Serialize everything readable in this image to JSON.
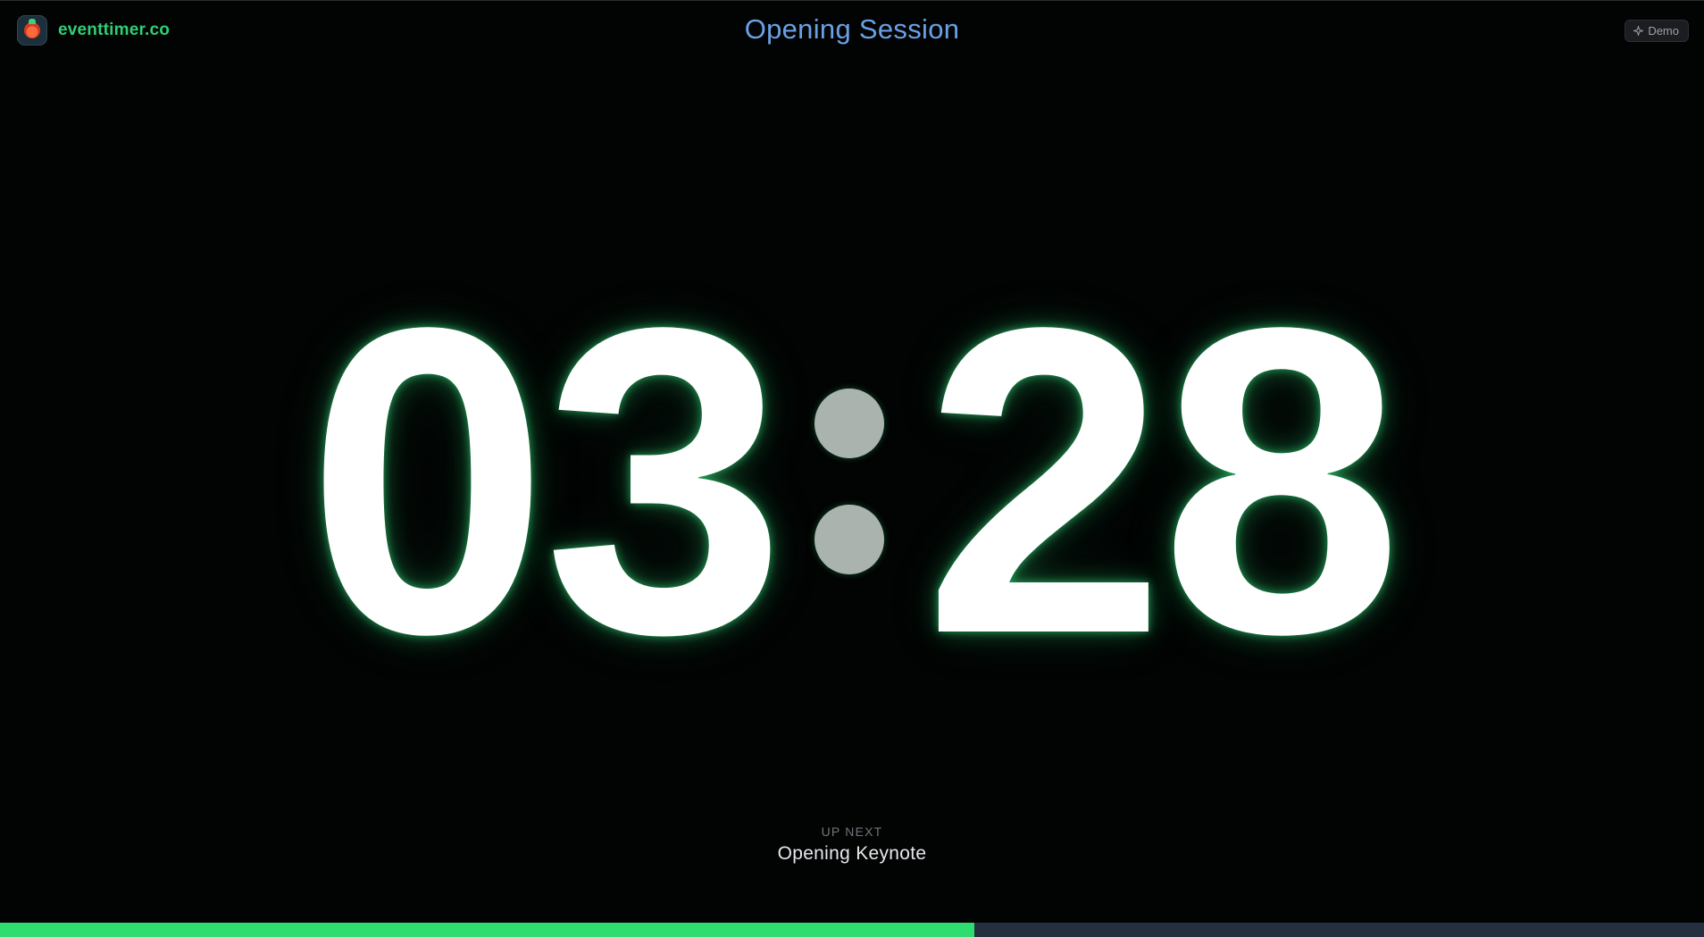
{
  "brand": {
    "name": "eventtimer.co",
    "logo_icon": "stopwatch-logo-icon"
  },
  "session": {
    "title": "Opening Session"
  },
  "badge": {
    "label": "Demo",
    "icon": "sparkle-icon"
  },
  "timer": {
    "minutes": "03",
    "seconds": "28"
  },
  "up_next": {
    "label": "UP NEXT",
    "title": "Opening Keynote"
  },
  "progress": {
    "fraction_elapsed": 0.572
  },
  "colors": {
    "brand": "#2fcf73",
    "title": "#6aa1e6",
    "progress_fill": "#2fdc6f",
    "progress_track": "#243040",
    "glow": "#2ecc71"
  }
}
